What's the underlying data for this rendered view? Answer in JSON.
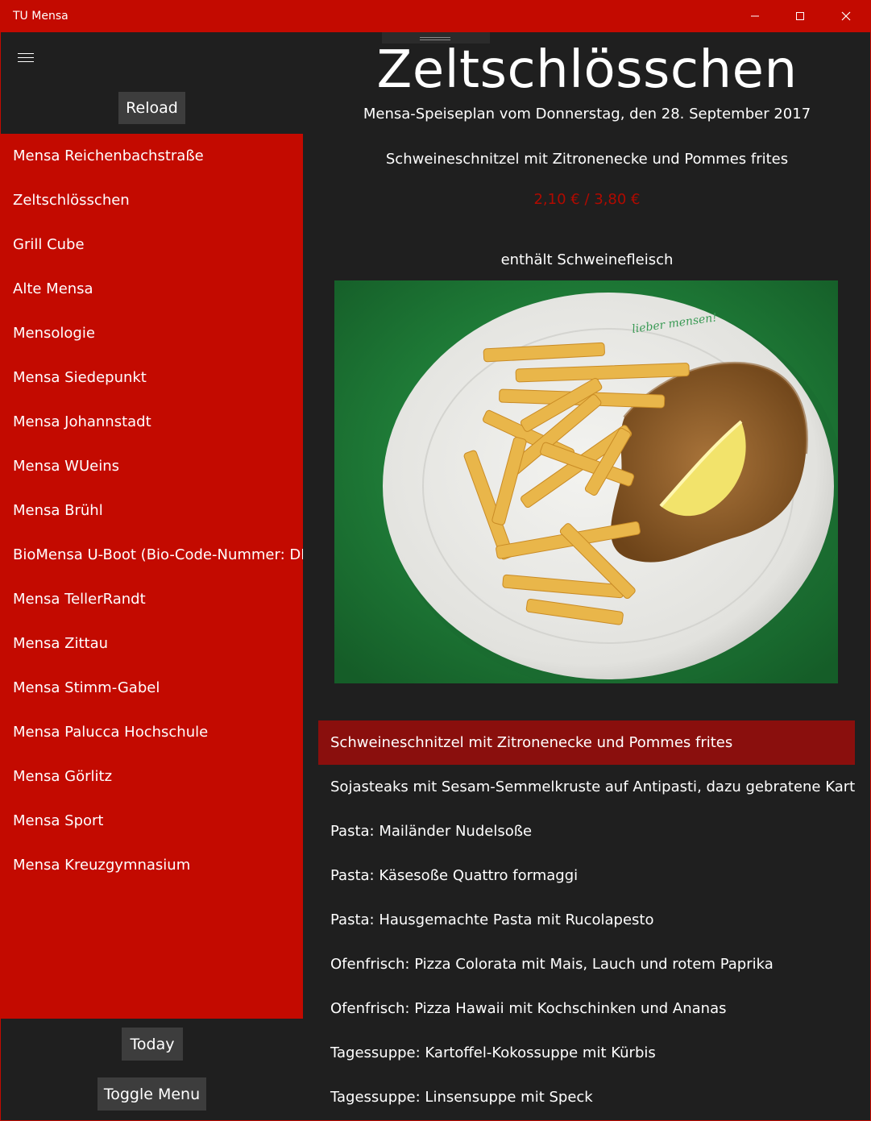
{
  "window": {
    "title": "TU Mensa"
  },
  "sidebar": {
    "reload_label": "Reload",
    "today_label": "Today",
    "toggle_label": "Toggle Menu",
    "items": [
      {
        "label": "Mensa Reichenbachstraße"
      },
      {
        "label": "Zeltschlösschen"
      },
      {
        "label": "Grill Cube"
      },
      {
        "label": "Alte Mensa"
      },
      {
        "label": "Mensologie"
      },
      {
        "label": "Mensa Siedepunkt"
      },
      {
        "label": "Mensa Johannstadt"
      },
      {
        "label": "Mensa WUeins"
      },
      {
        "label": "Mensa Brühl"
      },
      {
        "label": "BioMensa U-Boot (Bio-Code-Nummer: DE"
      },
      {
        "label": "Mensa TellerRandt"
      },
      {
        "label": "Mensa Zittau"
      },
      {
        "label": "Mensa Stimm-Gabel"
      },
      {
        "label": "Mensa Palucca Hochschule"
      },
      {
        "label": "Mensa Görlitz"
      },
      {
        "label": "Mensa Sport"
      },
      {
        "label": "Mensa Kreuzgymnasium"
      }
    ]
  },
  "main": {
    "hall_name": "Zeltschlösschen",
    "subtitle": "Mensa-Speiseplan vom Donnerstag, den 28. September 2017",
    "selected_meal": {
      "name": "Schweineschnitzel mit Zitronenecke und Pommes frites",
      "price": "2,10 € / 3,80 €",
      "notes": "enthält Schweinefleisch",
      "plate_logo_text": "lieber mensen!"
    },
    "meals": [
      {
        "label": "Schweineschnitzel mit Zitronenecke und Pommes frites",
        "selected": true
      },
      {
        "label": "Sojasteaks mit Sesam-Semmelkruste auf Antipasti, dazu gebratene Kartoffeln"
      },
      {
        "label": "Pasta: Mailänder Nudelsoße"
      },
      {
        "label": "Pasta: Käsesoße Quattro formaggi"
      },
      {
        "label": "Pasta: Hausgemachte Pasta mit Rucolapesto"
      },
      {
        "label": "Ofenfrisch: Pizza Colorata mit Mais, Lauch und rotem Paprika"
      },
      {
        "label": "Ofenfrisch: Pizza Hawaii mit Kochschinken und Ananas"
      },
      {
        "label": "Tagessuppe: Kartoffel-Kokossuppe mit Kürbis"
      },
      {
        "label": "Tagessuppe: Linsensuppe mit Speck"
      }
    ]
  },
  "colors": {
    "accent": "#c30a00",
    "selected_row": "#8a0f0d",
    "background": "#1f1f1f",
    "button": "#3d3d3d",
    "price": "#b00a00"
  },
  "icons": {
    "hamburger": "hamburger-icon",
    "minimize": "minimize-icon",
    "maximize": "maximize-icon",
    "close": "close-icon"
  }
}
